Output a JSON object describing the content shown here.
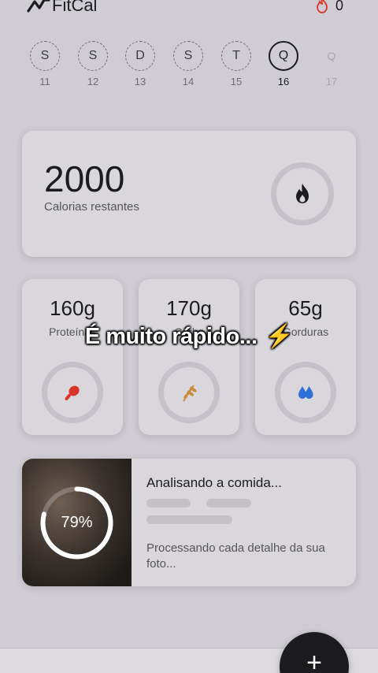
{
  "header": {
    "app_name": "FitCal",
    "streak_count": "0",
    "streak_icon": "flame-outline-icon",
    "logo_icon": "fitcal-logo-icon"
  },
  "days": [
    {
      "letter": "S",
      "num": "11"
    },
    {
      "letter": "S",
      "num": "12"
    },
    {
      "letter": "D",
      "num": "13"
    },
    {
      "letter": "S",
      "num": "14"
    },
    {
      "letter": "T",
      "num": "15"
    },
    {
      "letter": "Q",
      "num": "16"
    },
    {
      "letter": "Q",
      "num": "17"
    }
  ],
  "calories": {
    "value": "2000",
    "label": "Calorias restantes",
    "icon": "flame-icon"
  },
  "macros": [
    {
      "value": "160g",
      "label": "Proteínas",
      "icon": "drumstick-icon",
      "color": "#d9342b"
    },
    {
      "value": "170g",
      "label": "Carbs",
      "icon": "wheat-icon",
      "color": "#c98a3b"
    },
    {
      "value": "65g",
      "label": "Gorduras",
      "icon": "drops-icon",
      "color": "#2f6fd6"
    }
  ],
  "overlay": {
    "text": "É muito rápido...",
    "emoji": "⚡"
  },
  "analysis": {
    "progress_text": "79%",
    "progress": 0.79,
    "title": "Analisando a comida...",
    "description": "Processando cada detalhe da sua foto..."
  },
  "fab": {
    "label": "+"
  }
}
